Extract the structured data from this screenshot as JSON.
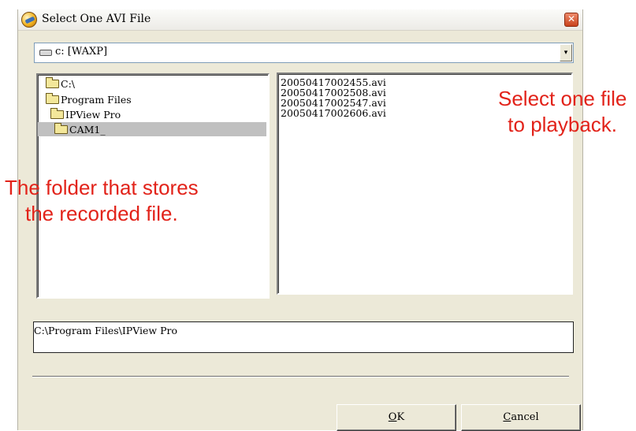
{
  "dialog": {
    "title": "Select One AVI File",
    "close_glyph": "✕",
    "icons": [
      "app-icon",
      "close-icon",
      "drive-icon",
      "folder-icon"
    ]
  },
  "drive_combo": {
    "value": "c: [WAXP]",
    "arrow": "▾"
  },
  "folders": [
    {
      "label": "C:\\",
      "indent": 0,
      "selected": false
    },
    {
      "label": "Program Files",
      "indent": 1,
      "selected": false
    },
    {
      "label": "IPView Pro",
      "indent": 1,
      "selected": false
    },
    {
      "label": "CAM1_",
      "indent": 2,
      "selected": true
    }
  ],
  "files": [
    "20050417002455.avi",
    "20050417002508.avi",
    "20050417002547.avi",
    "20050417002606.avi"
  ],
  "path": "C:\\Program Files\\IPView Pro",
  "buttons": {
    "ok": {
      "accel": "O",
      "rest": "K"
    },
    "cancel": {
      "accel": "C",
      "rest": "ancel"
    }
  },
  "annotations": {
    "files_note": [
      "Select one file",
      "to playback."
    ],
    "folder_note": [
      "The folder that stores",
      "the recorded file."
    ],
    "color": "#e2231a"
  }
}
